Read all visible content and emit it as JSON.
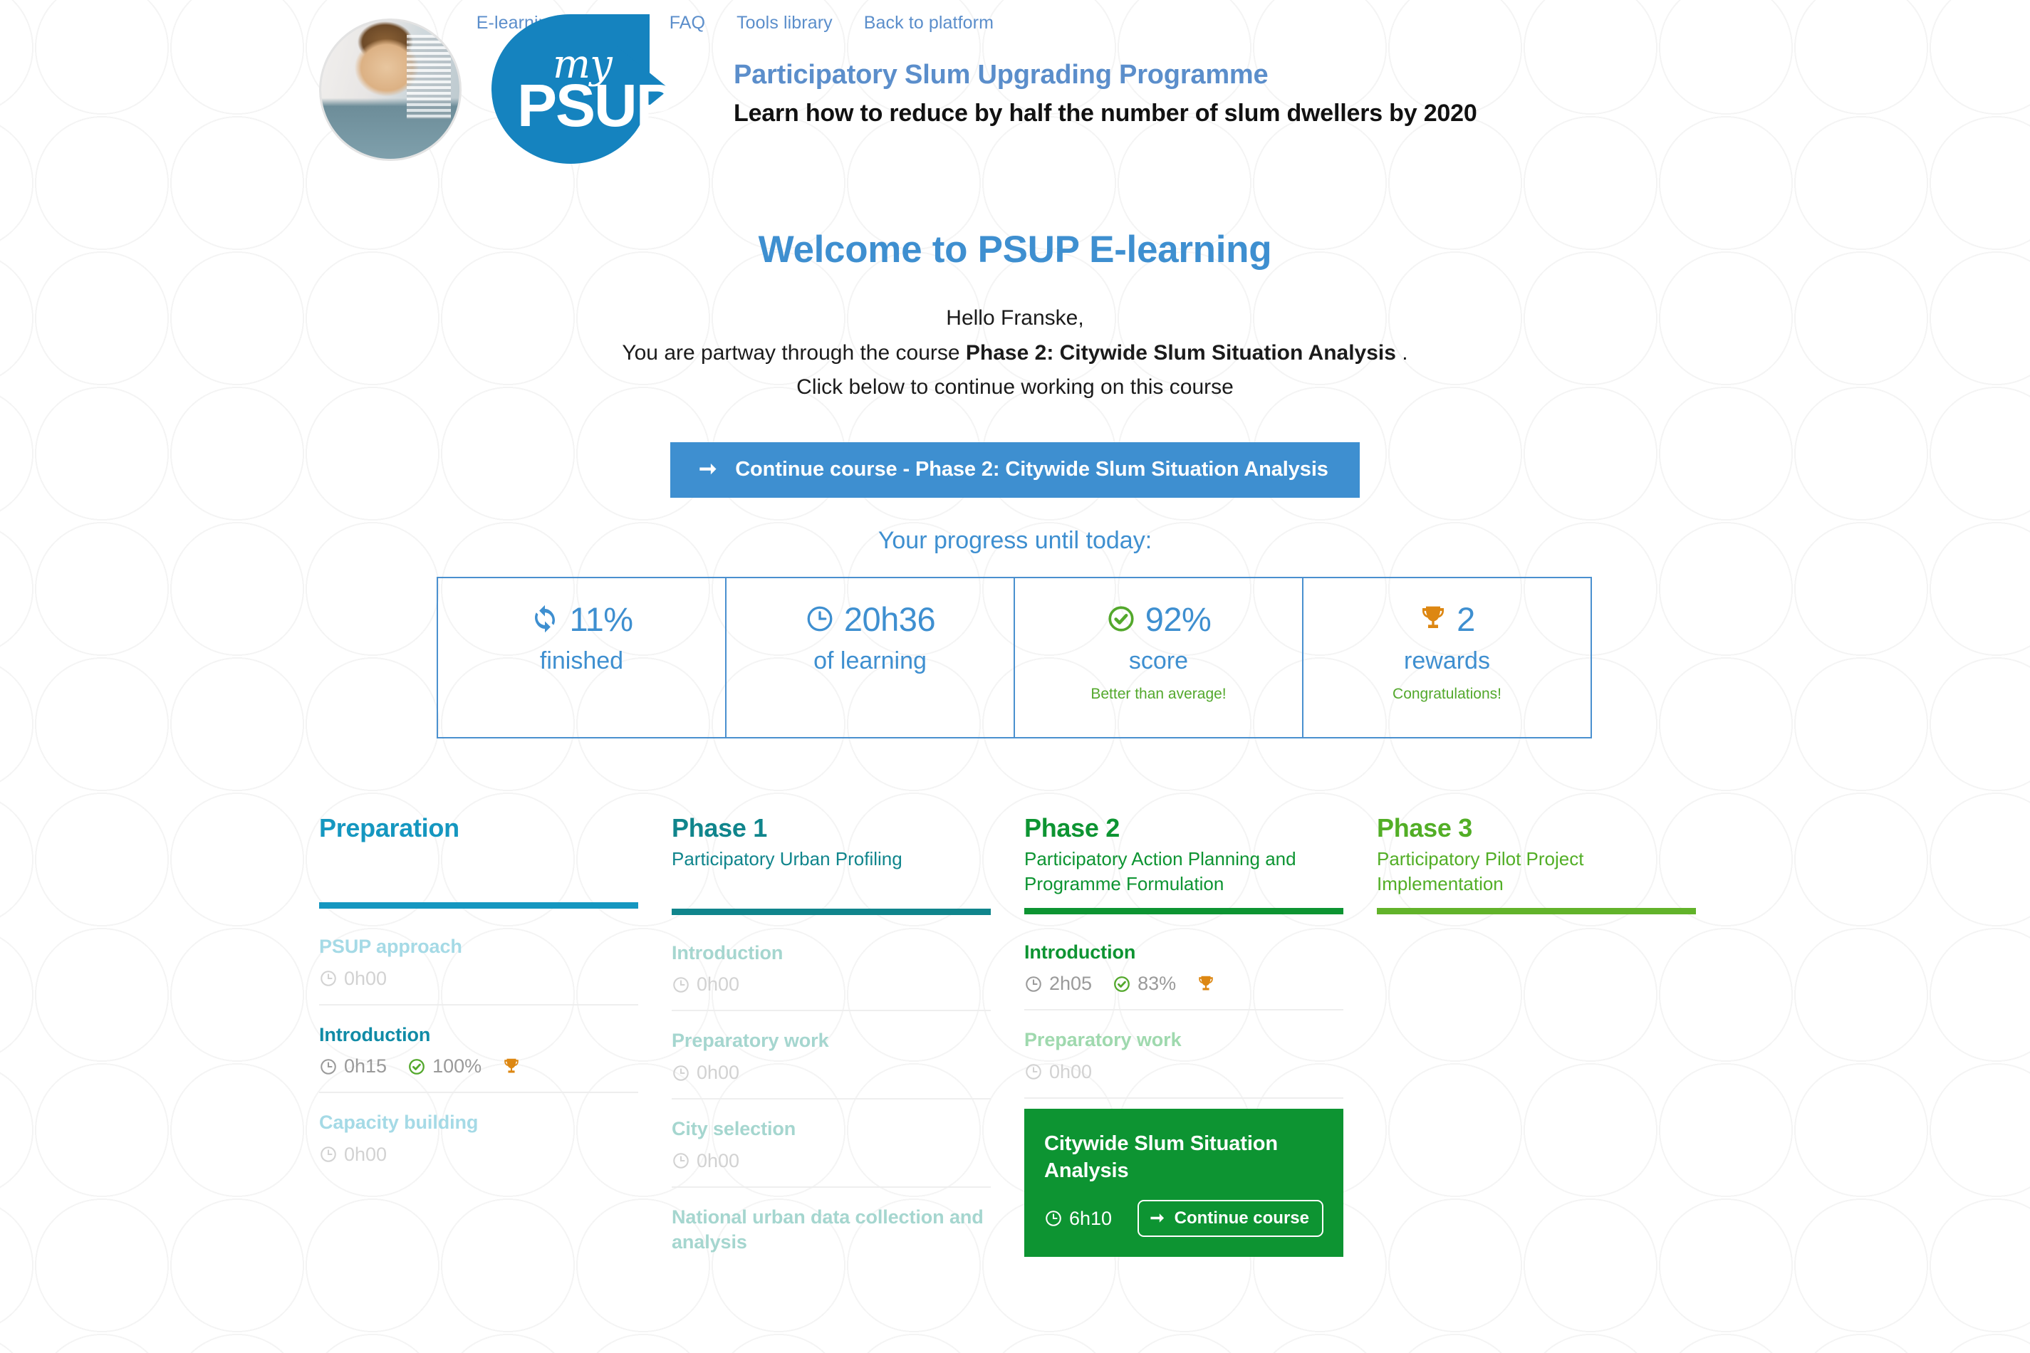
{
  "topnav": {
    "items": [
      {
        "label": "E-learning Overview"
      },
      {
        "label": "FAQ"
      },
      {
        "label": "Tools library"
      },
      {
        "label": "Back to platform"
      }
    ]
  },
  "header": {
    "logo_my": "my",
    "logo_psup": "PSUP",
    "title": "Participatory Slum Upgrading Programme",
    "subtitle": "Learn how to reduce by half the number of slum dwellers by 2020"
  },
  "welcome": {
    "heading": "Welcome to PSUP E-learning",
    "greeting": "Hello Franske,",
    "line2_prefix": "You are partway through the course ",
    "line2_course": "Phase 2: Citywide Slum Situation Analysis",
    "line2_suffix": " .",
    "line3": "Click below to continue working on this course",
    "continue_button": "Continue course - Phase 2: Citywide Slum Situation Analysis",
    "arrow_icon": "arrow-right-icon"
  },
  "progress": {
    "heading": "Your progress until today:",
    "stats": [
      {
        "icon": "refresh-icon",
        "value": "11%",
        "label": "finished",
        "note": ""
      },
      {
        "icon": "clock-icon",
        "value": "20h36",
        "label": "of learning",
        "note": ""
      },
      {
        "icon": "check-circle-icon",
        "value": "92%",
        "label": "score",
        "note": "Better than average!"
      },
      {
        "icon": "trophy-icon",
        "value": "2",
        "label": "rewards",
        "note": "Congratulations!"
      }
    ]
  },
  "colors": {
    "brand_blue": "#3e8fd0",
    "nav_blue": "#5b8ecb",
    "green": "#53a82c",
    "orange": "#dd8712",
    "grey": "#9a9a9a",
    "card_green": "#0d9432"
  },
  "phases": [
    {
      "title": "Preparation",
      "subtitle": "",
      "title_color": "#1597c0",
      "bar_color": "#1597c0",
      "modules": [
        {
          "name": "PSUP approach",
          "name_color": "#a5dae6",
          "time": "0h00",
          "time_color": "#d2d2d2",
          "score": null,
          "trophy": false,
          "highlight": false
        },
        {
          "name": "Introduction",
          "name_color": "#108ba6",
          "time": "0h15",
          "time_color": "#9a9a9a",
          "score": "100%",
          "score_color": "#9a9a9a",
          "trophy": true,
          "highlight": false
        },
        {
          "name": "Capacity building",
          "name_color": "#a5dae6",
          "time": "0h00",
          "time_color": "#d2d2d2",
          "score": null,
          "trophy": false,
          "highlight": false
        }
      ]
    },
    {
      "title": "Phase 1",
      "subtitle": "Participatory Urban Profiling",
      "title_color": "#10858c",
      "bar_color": "#10858c",
      "modules": [
        {
          "name": "Introduction",
          "name_color": "#a5d6cf",
          "time": "0h00",
          "time_color": "#d2d2d2",
          "score": null,
          "trophy": false,
          "highlight": false
        },
        {
          "name": "Preparatory work",
          "name_color": "#a5d6cf",
          "time": "0h00",
          "time_color": "#d2d2d2",
          "score": null,
          "trophy": false,
          "highlight": false
        },
        {
          "name": "City selection",
          "name_color": "#a5d6cf",
          "time": "0h00",
          "time_color": "#d2d2d2",
          "score": null,
          "trophy": false,
          "highlight": false
        },
        {
          "name": "National urban data collection and analysis",
          "name_color": "#a5d6cf",
          "time": "",
          "time_color": "#d2d2d2",
          "score": null,
          "trophy": false,
          "highlight": false
        }
      ]
    },
    {
      "title": "Phase 2",
      "subtitle": "Participatory Action Planning and Programme Formulation",
      "title_color": "#0d9432",
      "bar_color": "#0d9432",
      "modules": [
        {
          "name": "Introduction",
          "name_color": "#0d9432",
          "time": "2h05",
          "time_color": "#9a9a9a",
          "score": "83%",
          "score_color": "#9a9a9a",
          "trophy": true,
          "highlight": false
        },
        {
          "name": "Preparatory work",
          "name_color": "#9fd9ae",
          "time": "0h00",
          "time_color": "#d2d2d2",
          "score": null,
          "trophy": false,
          "highlight": false
        },
        {
          "name": "Citywide Slum Situation Analysis",
          "name_color": "#ffffff",
          "time": "6h10",
          "time_color": "#ffffff",
          "score": null,
          "trophy": false,
          "highlight": true,
          "button_label": "Continue course",
          "button_icon": "arrow-right-icon"
        }
      ]
    },
    {
      "title": "Phase 3",
      "subtitle": "Participatory Pilot Project Implementation",
      "title_color": "#52ae26",
      "bar_color": "#62b32a",
      "modules": []
    }
  ]
}
